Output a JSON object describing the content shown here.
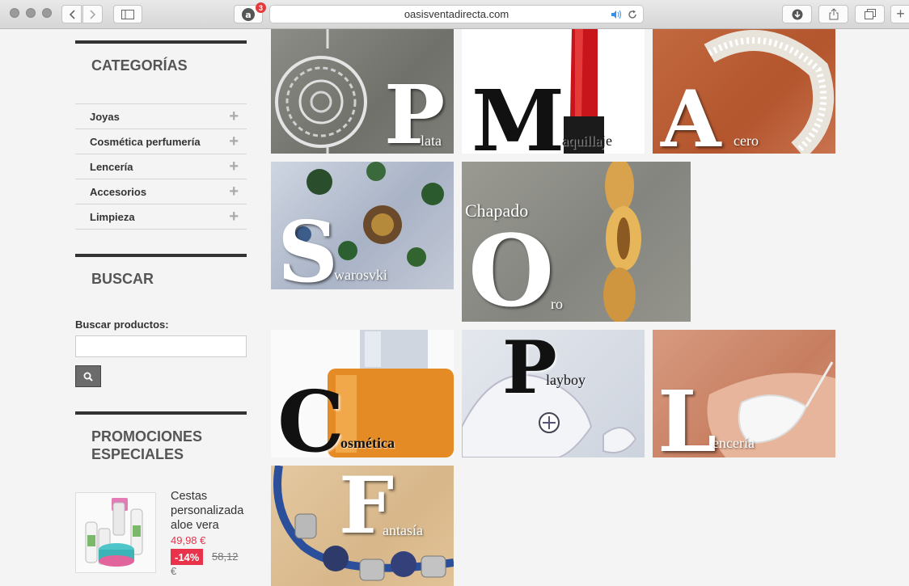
{
  "browser": {
    "url": "oasisventadirecta.com",
    "extension_badge": "3"
  },
  "sidebar": {
    "categories_title": "CATEGORÍAS",
    "categories": [
      {
        "label": "Joyas"
      },
      {
        "label": "Cosmética perfumería"
      },
      {
        "label": "Lencería"
      },
      {
        "label": "Accesorios"
      },
      {
        "label": "Limpieza"
      }
    ],
    "search_title": "BUSCAR",
    "search_label": "Buscar productos:",
    "search_value": "",
    "promo_title_line1": "PROMOCIONES",
    "promo_title_line2": "ESPECIALES",
    "promo": {
      "name": "Cestas personalizada aloe vera",
      "price": "49,98 €",
      "discount": "-14%",
      "old_price": "58,12",
      "currency": "€"
    }
  },
  "tiles": [
    {
      "letter": "P",
      "rest": "lata"
    },
    {
      "letter": "M",
      "rest": "aquillaje"
    },
    {
      "letter": "A",
      "rest": "cero"
    },
    {
      "letter": "S",
      "rest": "warosvki"
    },
    {
      "letter": "O",
      "rest": "ro",
      "prefix": "Chapado"
    },
    {
      "letter": "C",
      "rest": "osmética"
    },
    {
      "letter": "P",
      "rest": "layboy"
    },
    {
      "letter": "L",
      "rest": "encería"
    },
    {
      "letter": "F",
      "rest": "antasía"
    }
  ],
  "colors": {
    "accent": "#e8334a",
    "bar": "#333333",
    "title": "#555555"
  }
}
